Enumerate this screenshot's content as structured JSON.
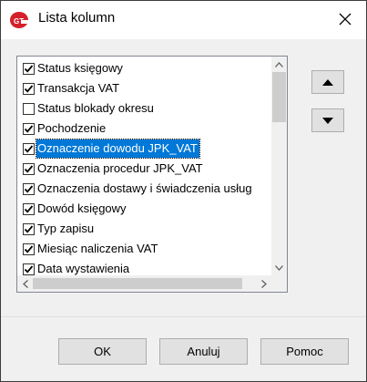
{
  "window": {
    "title": "Lista kolumn",
    "icon": "gt-logo-icon",
    "close_icon": "close-icon"
  },
  "list": {
    "items": [
      {
        "label": "Status księgowy",
        "checked": true,
        "selected": false
      },
      {
        "label": "Transakcja VAT",
        "checked": true,
        "selected": false
      },
      {
        "label": "Status blokady okresu",
        "checked": false,
        "selected": false
      },
      {
        "label": "Pochodzenie",
        "checked": true,
        "selected": false
      },
      {
        "label": "Oznaczenie dowodu JPK_VAT",
        "checked": true,
        "selected": true
      },
      {
        "label": "Oznaczenia procedur JPK_VAT",
        "checked": true,
        "selected": false
      },
      {
        "label": "Oznaczenia dostawy i świadczenia usług",
        "checked": true,
        "selected": false
      },
      {
        "label": "Dowód księgowy",
        "checked": true,
        "selected": false
      },
      {
        "label": "Typ zapisu",
        "checked": true,
        "selected": false
      },
      {
        "label": "Miesiąc naliczenia VAT",
        "checked": true,
        "selected": false
      },
      {
        "label": "Data wystawienia",
        "checked": true,
        "selected": false
      }
    ]
  },
  "side_buttons": {
    "up_icon": "triangle-up-icon",
    "down_icon": "triangle-down-icon"
  },
  "buttons": {
    "ok": "OK",
    "cancel": "Anuluj",
    "help": "Pomoc"
  },
  "colors": {
    "selection": "#0078d7",
    "button_face": "#e1e1e1",
    "dialog_bg": "#f0f0f0"
  }
}
